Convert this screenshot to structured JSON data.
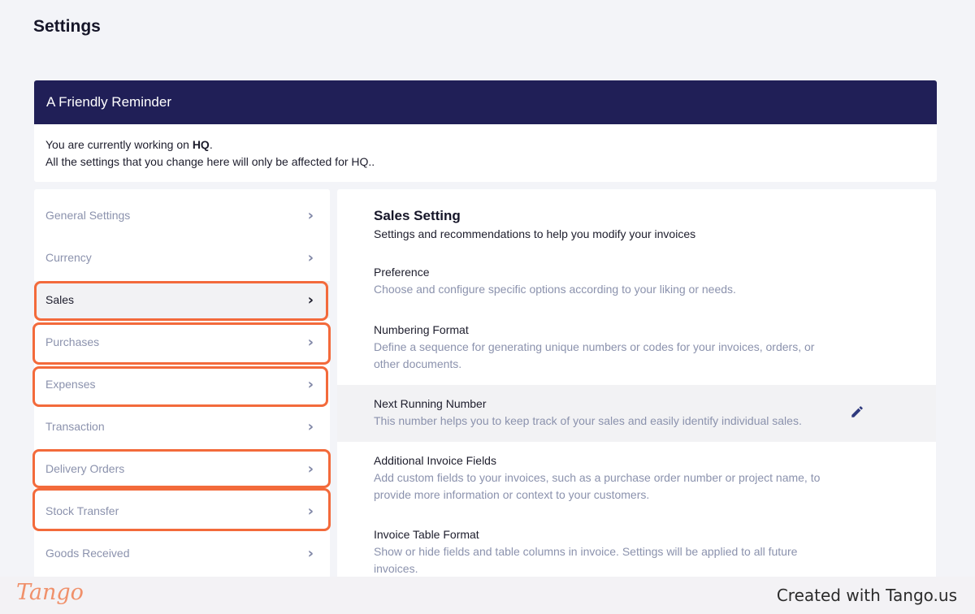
{
  "page": {
    "title": "Settings"
  },
  "reminder": {
    "heading": "A Friendly Reminder",
    "line1_prefix": "You are currently working on ",
    "line1_branch": "HQ",
    "line1_suffix": ".",
    "line2": "All the settings that you change here will only be affected for HQ.."
  },
  "sidebar": {
    "items": [
      {
        "label": "General Settings",
        "icon": "chevron-right-icon"
      },
      {
        "label": "Currency",
        "icon": "chevron-right-icon"
      },
      {
        "label": "Sales",
        "icon": "chevron-right-icon",
        "active": true
      },
      {
        "label": "Purchases",
        "icon": "chevron-right-icon"
      },
      {
        "label": "Expenses",
        "icon": "chevron-right-icon"
      },
      {
        "label": "Transaction",
        "icon": "chevron-right-icon"
      },
      {
        "label": "Delivery Orders",
        "icon": "chevron-right-icon"
      },
      {
        "label": "Stock Transfer",
        "icon": "chevron-right-icon"
      },
      {
        "label": "Goods Received",
        "icon": "chevron-right-icon"
      }
    ]
  },
  "main": {
    "title": "Sales Setting",
    "subtitle": "Settings and recommendations to help you modify your invoices",
    "sections": [
      {
        "title": "Preference",
        "description": "Choose and configure specific options according to your liking or needs."
      },
      {
        "title": "Numbering Format",
        "description": "Define a sequence for generating unique numbers or codes for your invoices, orders, or other documents."
      },
      {
        "title": "Next Running Number",
        "description": "This number helps you to keep track of your sales and easily identify individual sales.",
        "icon": "pencil-edit-icon"
      },
      {
        "title": "Additional Invoice Fields",
        "description": "Add custom fields to your invoices, such as a purchase order number or project name, to provide more information or context to your customers."
      },
      {
        "title": "Invoice Table Format",
        "description": "Show or hide fields and table columns in invoice. Settings will be applied to all future invoices."
      }
    ]
  },
  "footer": {
    "logo": "Tango",
    "created_text": "Created with Tango.us"
  },
  "colors": {
    "reminder_header": "#201f57",
    "highlight": "#f36a3b",
    "muted_text": "#8b92ad",
    "page_bg": "#f3f4f8"
  }
}
